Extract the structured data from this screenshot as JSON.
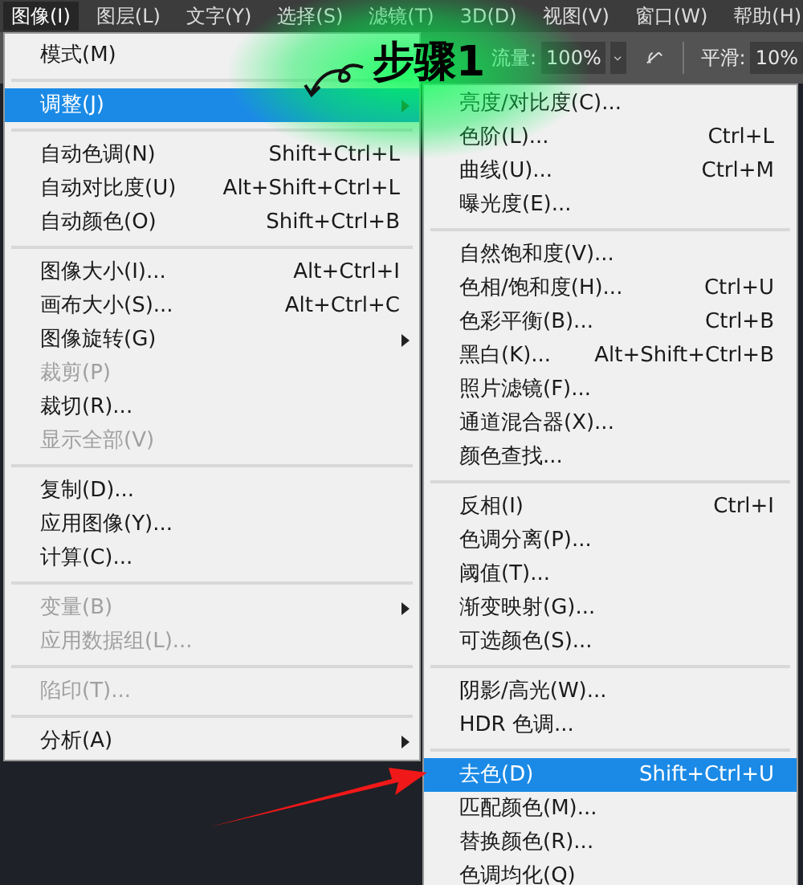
{
  "menubar": [
    {
      "label": "图像(I)",
      "selected": true
    },
    {
      "label": "图层(L)",
      "selected": false
    },
    {
      "label": "文字(Y)",
      "selected": false
    },
    {
      "label": "选择(S)",
      "selected": false
    },
    {
      "label": "滤镜(T)",
      "selected": false
    },
    {
      "label": "3D(D)",
      "selected": false
    },
    {
      "label": "视图(V)",
      "selected": false
    },
    {
      "label": "窗口(W)",
      "selected": false
    },
    {
      "label": "帮助(H)",
      "selected": false
    }
  ],
  "toolbar": {
    "flow_label": "流量:",
    "flow_value": "100%",
    "smooth_label": "平滑:",
    "smooth_value": "10%"
  },
  "annotation": {
    "label": "步骤1"
  },
  "image_menu": [
    {
      "kind": "item",
      "label": "模式(M)",
      "disabled": false,
      "submenu": false,
      "selected": false
    },
    {
      "kind": "separator"
    },
    {
      "kind": "item",
      "label": "调整(J)",
      "disabled": false,
      "submenu": true,
      "selected": true
    },
    {
      "kind": "separator"
    },
    {
      "kind": "item",
      "label": "自动色调(N)",
      "shortcut": "Shift+Ctrl+L",
      "disabled": false,
      "submenu": false,
      "selected": false
    },
    {
      "kind": "item",
      "label": "自动对比度(U)",
      "shortcut": "Alt+Shift+Ctrl+L",
      "disabled": false,
      "submenu": false,
      "selected": false
    },
    {
      "kind": "item",
      "label": "自动颜色(O)",
      "shortcut": "Shift+Ctrl+B",
      "disabled": false,
      "submenu": false,
      "selected": false
    },
    {
      "kind": "separator"
    },
    {
      "kind": "item",
      "label": "图像大小(I)...",
      "shortcut": "Alt+Ctrl+I",
      "disabled": false,
      "submenu": false,
      "selected": false
    },
    {
      "kind": "item",
      "label": "画布大小(S)...",
      "shortcut": "Alt+Ctrl+C",
      "disabled": false,
      "submenu": false,
      "selected": false
    },
    {
      "kind": "item",
      "label": "图像旋转(G)",
      "disabled": false,
      "submenu": true,
      "selected": false
    },
    {
      "kind": "item",
      "label": "裁剪(P)",
      "disabled": true,
      "submenu": false,
      "selected": false
    },
    {
      "kind": "item",
      "label": "裁切(R)...",
      "disabled": false,
      "submenu": false,
      "selected": false
    },
    {
      "kind": "item",
      "label": "显示全部(V)",
      "disabled": true,
      "submenu": false,
      "selected": false
    },
    {
      "kind": "separator"
    },
    {
      "kind": "item",
      "label": "复制(D)...",
      "disabled": false,
      "submenu": false,
      "selected": false
    },
    {
      "kind": "item",
      "label": "应用图像(Y)...",
      "disabled": false,
      "submenu": false,
      "selected": false
    },
    {
      "kind": "item",
      "label": "计算(C)...",
      "disabled": false,
      "submenu": false,
      "selected": false
    },
    {
      "kind": "separator"
    },
    {
      "kind": "item",
      "label": "变量(B)",
      "disabled": true,
      "submenu": true,
      "selected": false
    },
    {
      "kind": "item",
      "label": "应用数据组(L)...",
      "disabled": true,
      "submenu": false,
      "selected": false
    },
    {
      "kind": "separator"
    },
    {
      "kind": "item",
      "label": "陷印(T)...",
      "disabled": true,
      "submenu": false,
      "selected": false
    },
    {
      "kind": "separator"
    },
    {
      "kind": "item",
      "label": "分析(A)",
      "disabled": false,
      "submenu": true,
      "selected": false
    }
  ],
  "adjust_menu": [
    {
      "kind": "item",
      "label": "亮度/对比度(C)...",
      "selected": false
    },
    {
      "kind": "item",
      "label": "色阶(L)...",
      "shortcut": "Ctrl+L",
      "selected": false
    },
    {
      "kind": "item",
      "label": "曲线(U)...",
      "shortcut": "Ctrl+M",
      "selected": false
    },
    {
      "kind": "item",
      "label": "曝光度(E)...",
      "selected": false
    },
    {
      "kind": "separator"
    },
    {
      "kind": "item",
      "label": "自然饱和度(V)...",
      "selected": false
    },
    {
      "kind": "item",
      "label": "色相/饱和度(H)...",
      "shortcut": "Ctrl+U",
      "selected": false
    },
    {
      "kind": "item",
      "label": "色彩平衡(B)...",
      "shortcut": "Ctrl+B",
      "selected": false
    },
    {
      "kind": "item",
      "label": "黑白(K)...",
      "shortcut": "Alt+Shift+Ctrl+B",
      "selected": false
    },
    {
      "kind": "item",
      "label": "照片滤镜(F)...",
      "selected": false
    },
    {
      "kind": "item",
      "label": "通道混合器(X)...",
      "selected": false
    },
    {
      "kind": "item",
      "label": "颜色查找...",
      "selected": false
    },
    {
      "kind": "separator"
    },
    {
      "kind": "item",
      "label": "反相(I)",
      "shortcut": "Ctrl+I",
      "selected": false
    },
    {
      "kind": "item",
      "label": "色调分离(P)...",
      "selected": false
    },
    {
      "kind": "item",
      "label": "阈值(T)...",
      "selected": false
    },
    {
      "kind": "item",
      "label": "渐变映射(G)...",
      "selected": false
    },
    {
      "kind": "item",
      "label": "可选颜色(S)...",
      "selected": false
    },
    {
      "kind": "separator"
    },
    {
      "kind": "item",
      "label": "阴影/高光(W)...",
      "selected": false
    },
    {
      "kind": "item",
      "label": "HDR 色调...",
      "selected": false
    },
    {
      "kind": "separator"
    },
    {
      "kind": "item",
      "label": "去色(D)",
      "shortcut": "Shift+Ctrl+U",
      "selected": true
    },
    {
      "kind": "item",
      "label": "匹配颜色(M)...",
      "selected": false
    },
    {
      "kind": "item",
      "label": "替换颜色(R)...",
      "selected": false
    },
    {
      "kind": "item",
      "label": "色调均化(Q)",
      "selected": false
    }
  ]
}
